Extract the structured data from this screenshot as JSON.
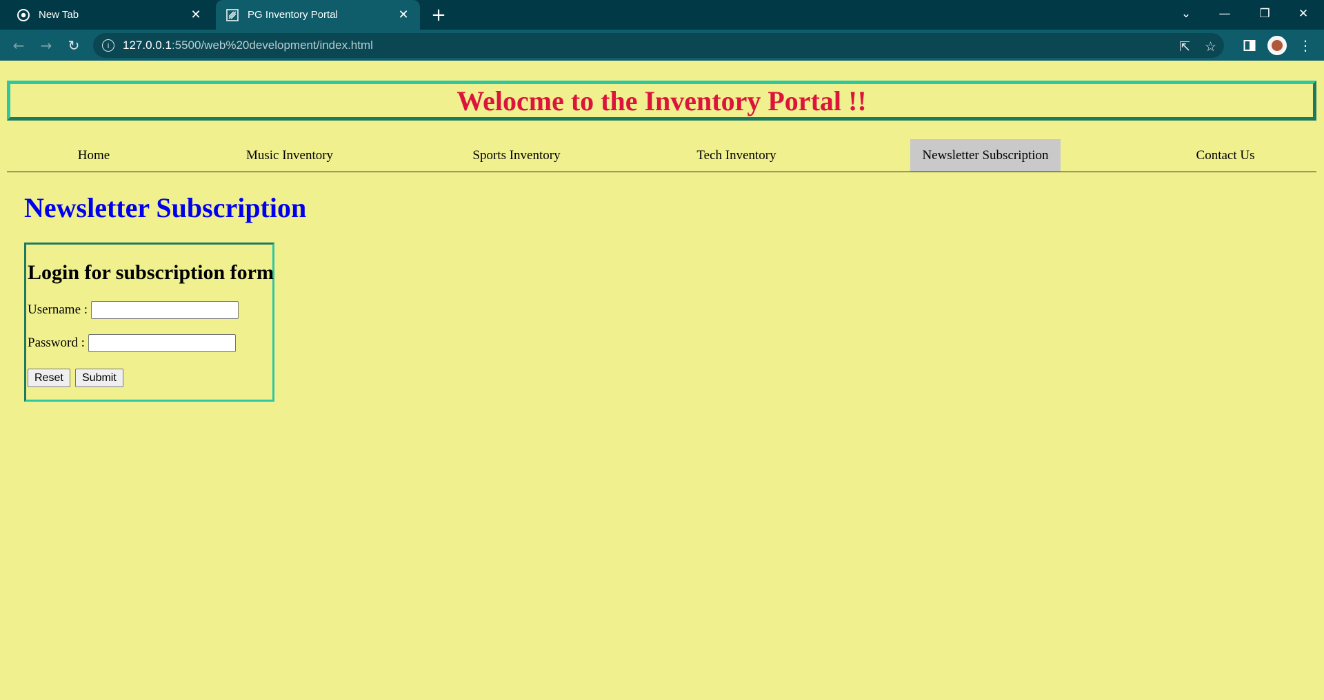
{
  "browser": {
    "tabs": [
      {
        "title": "New Tab"
      },
      {
        "title": "PG Inventory Portal"
      }
    ],
    "url_host": "127.0.0.1",
    "url_path": ":5500/web%20development/index.html"
  },
  "page": {
    "banner": "Welocme to the Inventory Portal !!",
    "nav": [
      {
        "label": "Home"
      },
      {
        "label": "Music Inventory"
      },
      {
        "label": "Sports Inventory"
      },
      {
        "label": "Tech Inventory"
      },
      {
        "label": "Newsletter Subscription"
      },
      {
        "label": "Contact Us"
      }
    ],
    "section_title": "Newsletter Subscription",
    "form": {
      "title": "Login for subscription form",
      "username_label": "Username :",
      "username_value": "",
      "password_label": "Password :",
      "password_value": "",
      "reset_label": "Reset",
      "submit_label": "Submit"
    }
  },
  "colors": {
    "page_bg": "#f0f08f",
    "banner_text": "#dc143c",
    "section_title": "#0000ee",
    "border_accent": "#2fc7a1",
    "tab_bar": "#013a46",
    "active_nav_bg": "#c9c9c9"
  }
}
